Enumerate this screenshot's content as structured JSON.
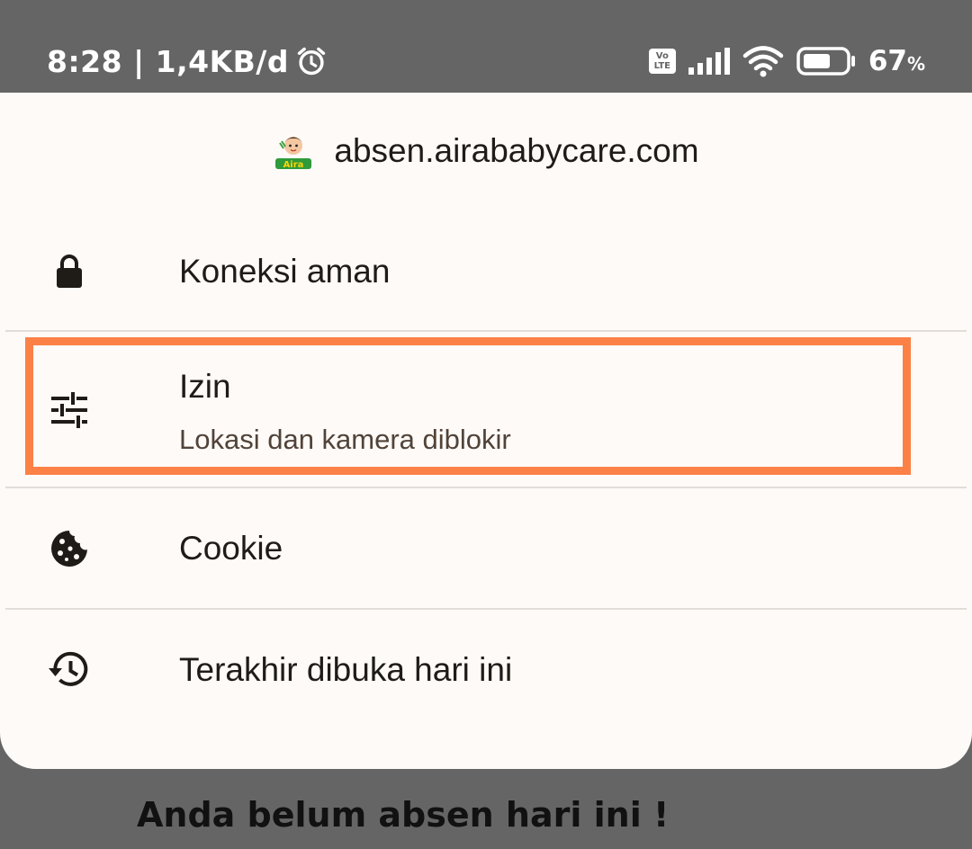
{
  "status_bar": {
    "time_speed": "8:28 | 1,4KB/d",
    "volte": [
      "Vo",
      "LTE"
    ],
    "battery_percent": "67",
    "battery_unit": "%",
    "battery_level": 0.67,
    "icons": [
      "alarm-icon",
      "volte-icon",
      "signal-icon",
      "wifi-icon",
      "battery-icon"
    ]
  },
  "site_info": {
    "domain": "absen.airababycare.com",
    "logo_text": "Aira",
    "items": [
      {
        "icon": "lock-icon",
        "label": "Koneksi aman"
      },
      {
        "icon": "tune-icon",
        "label": "Izin",
        "sublabel": "Lokasi dan kamera diblokir",
        "highlighted": true
      },
      {
        "icon": "cookie-icon",
        "label": "Cookie"
      },
      {
        "icon": "history-icon",
        "label": "Terakhir dibuka hari ini"
      }
    ]
  },
  "background_page": {
    "heading": "Anda belum absen hari ini !"
  },
  "colors": {
    "scrim": "#666565",
    "sheet": "#fefaf8",
    "highlight": "#fb8146",
    "text": "#1f1b17"
  }
}
